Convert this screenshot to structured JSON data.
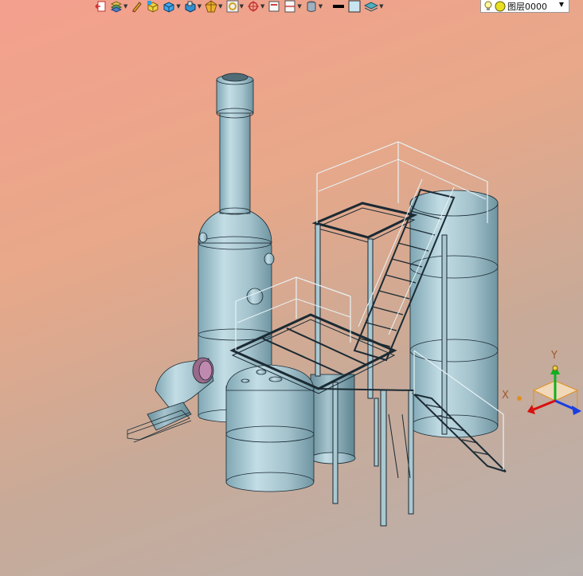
{
  "toolbar": {
    "buttons": [
      {
        "icon": "exit-sketch-icon",
        "dropdown": false
      },
      {
        "icon": "layers-stack-icon",
        "dropdown": true
      },
      {
        "icon": "pencil-icon",
        "dropdown": false
      },
      {
        "icon": "yellow-cube-icon",
        "dropdown": false
      },
      {
        "icon": "blue-box-icon",
        "dropdown": true
      },
      {
        "icon": "view-cube-icon",
        "dropdown": true
      },
      {
        "icon": "render-style-icon",
        "dropdown": true
      },
      {
        "icon": "zoom-fit-icon",
        "dropdown": true
      },
      {
        "icon": "orient-view-icon",
        "dropdown": true
      },
      {
        "icon": "single-view-icon",
        "dropdown": false
      },
      {
        "icon": "split-view-icon",
        "dropdown": true
      },
      {
        "icon": "background-icon",
        "dropdown": true
      },
      {
        "icon": "line-weight-icon",
        "dropdown": false
      },
      {
        "icon": "color-swatch-icon",
        "dropdown": false
      },
      {
        "icon": "layer-manager-icon",
        "dropdown": true
      }
    ]
  },
  "layer": {
    "current": "图层0000",
    "visible_icon": "lightbulb-icon",
    "color_icon": "yellow-dot-icon"
  },
  "triad": {
    "x_label": "X",
    "y_label": "Y",
    "colors": {
      "x": "#d81010",
      "y": "#10b020",
      "z": "#1a3ee0",
      "orange": "#e09020"
    }
  },
  "colors": {
    "model_fill": "#a9c8d2",
    "model_edge": "#1b2a33"
  }
}
